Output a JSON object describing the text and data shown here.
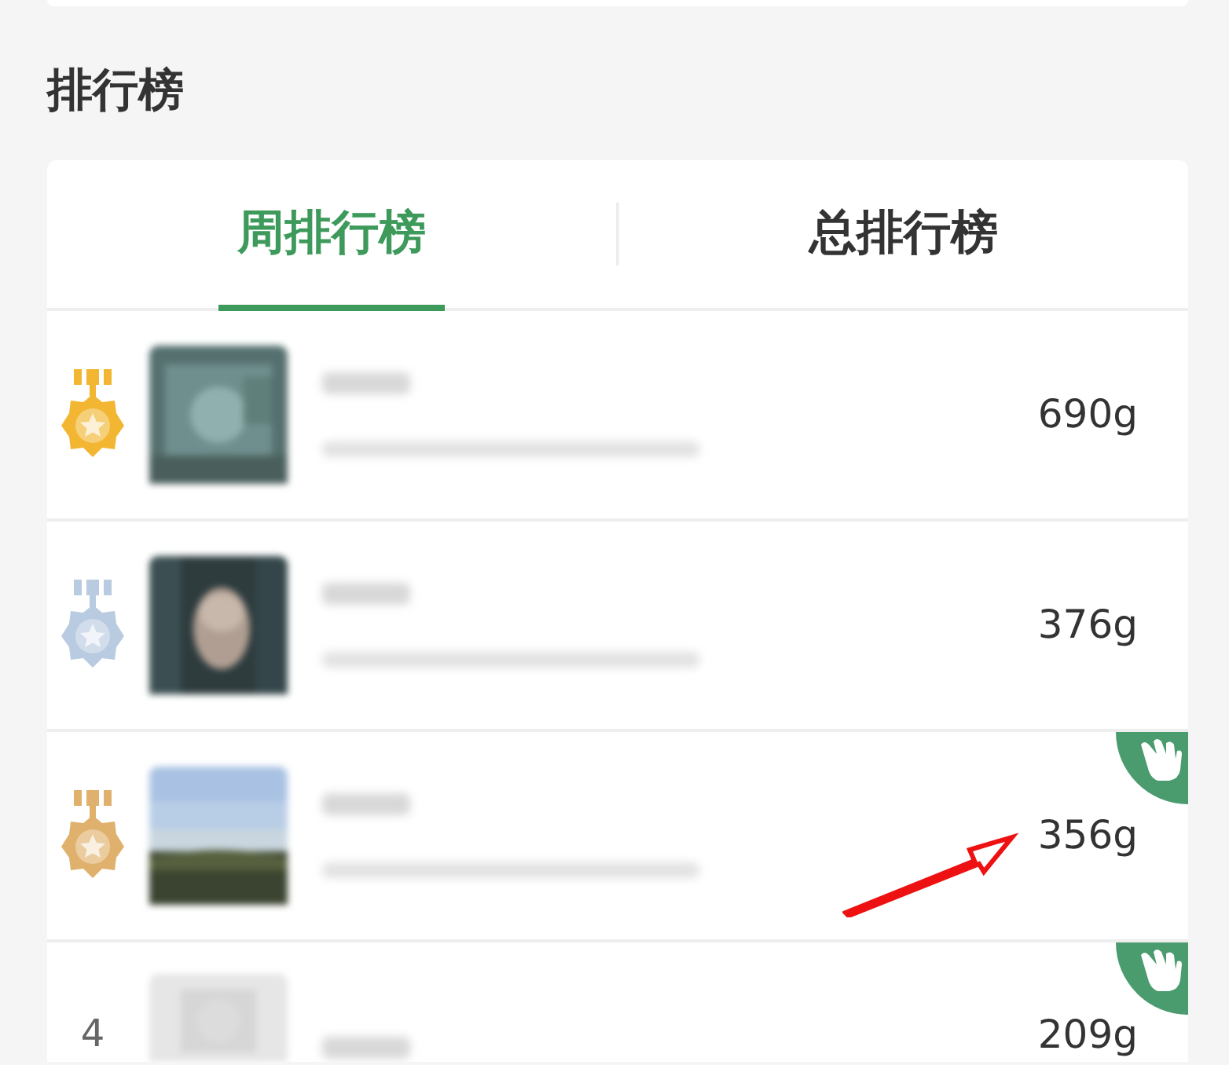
{
  "section_title": "排行榜",
  "tabs": [
    {
      "label": "周排行榜",
      "selected": true
    },
    {
      "label": "总排行榜",
      "selected": false
    }
  ],
  "rows": [
    {
      "rank": {
        "kind": "medal",
        "color": "#f2b632"
      },
      "value": "690g",
      "hand_badge": false
    },
    {
      "rank": {
        "kind": "medal",
        "color": "#b9cbe0"
      },
      "value": "376g",
      "hand_badge": false
    },
    {
      "rank": {
        "kind": "medal",
        "color": "#e0b16c"
      },
      "value": "356g",
      "hand_badge": true
    },
    {
      "rank": {
        "kind": "number",
        "label": "4"
      },
      "value": "209g",
      "hand_badge": true
    }
  ]
}
